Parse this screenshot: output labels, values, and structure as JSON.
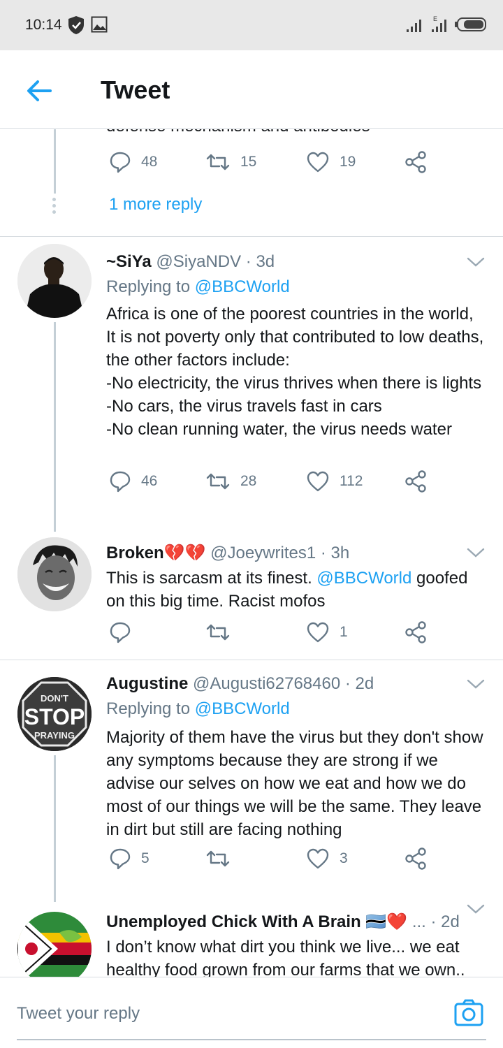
{
  "status_bar": {
    "time": "10:14"
  },
  "header": {
    "title": "Tweet"
  },
  "thread_top": {
    "clipped_text": "defense mechanism and antibodies",
    "replies": "48",
    "retweets": "15",
    "likes": "19",
    "more_reply": "1 more reply"
  },
  "tweets": [
    {
      "name": "~SiYa",
      "handle": "@SiyaNDV · 3d",
      "replying_label": "Replying to",
      "replying_to": "@BBCWorld",
      "text": "Africa is one of the poorest countries in the world, It is not poverty only that contributed to low deaths, the other factors include:\n-No electricity, the virus thrives when there is lights\n-No cars, the virus travels fast in cars\n-No clean running water, the virus needs water",
      "replies": "46",
      "retweets": "28",
      "likes": "112"
    },
    {
      "name": "Broken💔💔",
      "handle": "@Joeywrites1 · 3h",
      "text_before": "This is sarcasm at its finest. ",
      "mention": "@BBCWorld",
      "text_after": " goofed on this big time. Racist mofos",
      "replies": "",
      "retweets": "",
      "likes": "1"
    },
    {
      "name": "Augustine",
      "handle": "@Augusti62768460 · 2d",
      "replying_label": "Replying to",
      "replying_to": "@BBCWorld",
      "avatar_text": [
        "DON'T",
        "STOP",
        "PRAYING"
      ],
      "text": "Majority of them have the virus but they don't show any symptoms because they are strong if we advise our selves on how we eat and how we do most of our things we will be the same. They leave in dirt but still are facing nothing",
      "replies": "5",
      "retweets": "",
      "likes": "3"
    },
    {
      "name": "Unemployed Chick With A Brain",
      "flag": "🇧🇼",
      "heart": "❤️",
      "handle": "... · 2d",
      "text": "I don’t know what dirt you think we live... we eat healthy food grown from our farms that we own.."
    }
  ],
  "reply_bar": {
    "placeholder": "Tweet your reply"
  },
  "colors": {
    "accent": "#1da1f2",
    "muted": "#657786",
    "thread_line": "#c4cfd6"
  }
}
